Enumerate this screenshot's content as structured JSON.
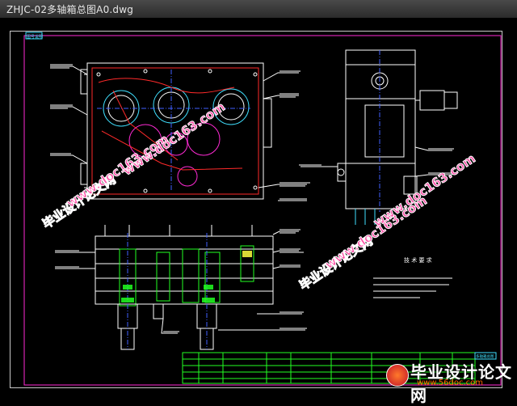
{
  "window": {
    "title": "ZHJC-02多轴箱总图A0.dwg"
  },
  "drawing": {
    "top_left_tag": "图号说明",
    "title_block_tag": "多轴箱总图",
    "tech_requirements_title": "技 术 要 求"
  },
  "watermarks": {
    "site_cn": "毕业设计论文网",
    "site_url": "www.doc163.com"
  },
  "brand": {
    "name": "毕业设计论文网",
    "url": "www.56doc.com"
  },
  "colors": {
    "background": "#000000",
    "line_white": "#ffffff",
    "line_red": "#ff2a2a",
    "line_magenta": "#ff2ad4",
    "line_green": "#22ff22",
    "line_cyan": "#40e0ff",
    "line_yellow": "#ffff40",
    "line_blue": "#4060ff",
    "watermark": "#ff4da6"
  }
}
